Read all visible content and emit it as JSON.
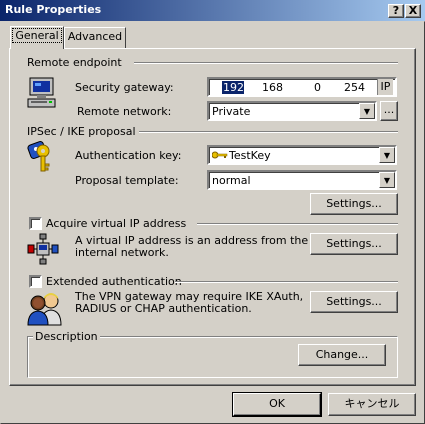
{
  "window": {
    "title": "Rule Properties",
    "help_label": "?",
    "close_label": "X"
  },
  "tabs": [
    {
      "label": "General"
    },
    {
      "label": "Advanced"
    }
  ],
  "remote_endpoint": {
    "heading": "Remote endpoint",
    "gateway_label": "Security gateway:",
    "ip": [
      "192",
      "168",
      "0",
      "254"
    ],
    "ip_toggle": "IP",
    "network_label": "Remote network:",
    "network_value": "Private",
    "browse_label": "..."
  },
  "proposal": {
    "heading": "IPSec / IKE proposal",
    "auth_key_label": "Authentication key:",
    "auth_key_value": "TestKey",
    "template_label": "Proposal template:",
    "template_value": "normal",
    "settings_label": "Settings..."
  },
  "virtual_ip": {
    "checkbox_label": "Acquire virtual IP address",
    "checked": false,
    "description_1": "A virtual IP address is an address from the",
    "description_2": "internal network.",
    "settings_label": "Settings..."
  },
  "extended_auth": {
    "checkbox_label": "Extended authentication",
    "checked": false,
    "description_1": "The VPN gateway may require IKE XAuth,",
    "description_2": "RADIUS or CHAP authentication.",
    "settings_label": "Settings..."
  },
  "description_box": {
    "heading": "Description",
    "change_label": "Change..."
  },
  "footer": {
    "ok_label": "OK",
    "cancel_label": "キャンセル"
  },
  "colors": {
    "titlebar_start": "#0a246a",
    "titlebar_end": "#a6caf0",
    "face": "#d4d0c8",
    "selection": "#0a246a"
  }
}
